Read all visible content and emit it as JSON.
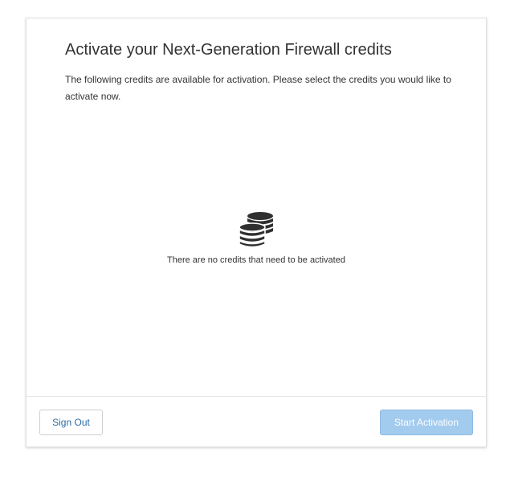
{
  "dialog": {
    "title": "Activate your Next-Generation Firewall credits",
    "description": "The following credits are available for activation. Please select the credits you would like to activate now."
  },
  "empty_state": {
    "icon": "coins-icon",
    "message": "There are no credits that need to be activated"
  },
  "footer": {
    "sign_out_label": "Sign Out",
    "start_activation_label": "Start Activation",
    "start_activation_disabled": true
  },
  "colors": {
    "link_blue": "#2c6aa6",
    "disabled_primary": "#a2cbee",
    "text": "#333333"
  }
}
